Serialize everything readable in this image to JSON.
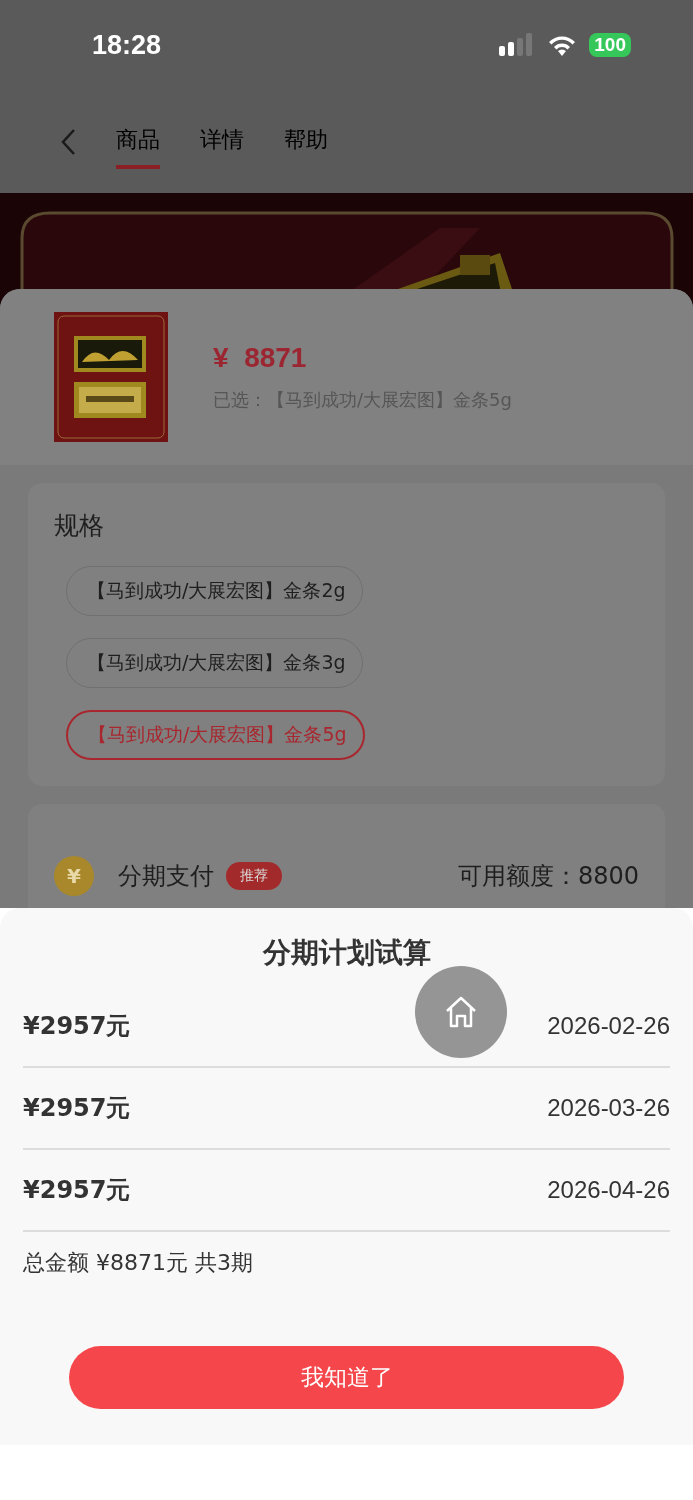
{
  "status_bar": {
    "time": "18:28",
    "battery": "100"
  },
  "nav": {
    "tabs": [
      {
        "label": "商品",
        "selected": true
      },
      {
        "label": "详情",
        "selected": false
      },
      {
        "label": "帮助",
        "selected": false
      }
    ]
  },
  "product": {
    "price_symbol": "¥",
    "price": "8871",
    "selected_label": "已选：【马到成功/大展宏图】金条5g"
  },
  "spec": {
    "title": "规格",
    "options": [
      {
        "label": "【马到成功/大展宏图】金条2g",
        "selected": false
      },
      {
        "label": "【马到成功/大展宏图】金条3g",
        "selected": false
      },
      {
        "label": "【马到成功/大展宏图】金条5g",
        "selected": true
      }
    ]
  },
  "payment": {
    "label": "分期支付",
    "badge": "推荐",
    "credit": "可用额度：8800",
    "coin": "¥"
  },
  "plan": {
    "title": "分期计划试算",
    "rows": [
      {
        "amount": "¥2957元",
        "date": "2026-02-26"
      },
      {
        "amount": "¥2957元",
        "date": "2026-03-26"
      },
      {
        "amount": "¥2957元",
        "date": "2026-04-26"
      }
    ],
    "total": "总金额 ¥8871元 共3期",
    "button": "我知道了"
  }
}
